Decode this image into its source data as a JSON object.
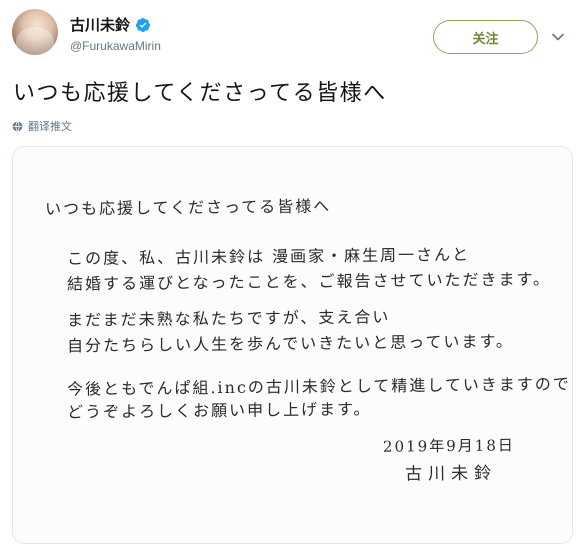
{
  "user": {
    "display_name": "古川未鈴",
    "handle": "@FurukawaMirin",
    "verified": true
  },
  "follow_button": {
    "label": "关注"
  },
  "tweet": {
    "text": "いつも応援してくださってる皆様へ",
    "translate_label": "翻译推文"
  },
  "letter": {
    "greeting": "いつも応援してくださってる皆様へ",
    "lines": [
      "この度、私、古川未鈴は 漫画家・麻生周一さんと",
      "結婚する運びとなったことを、ご報告させていただきます。",
      "まだまだ未熟な私たちですが、支え合い",
      "自分たちらしい人生を歩んでいきたいと思っています。",
      "今後ともでんぱ組.incの古川未鈴として精進していきますので",
      "どうぞよろしくお願い申し上げます。"
    ],
    "date": "2019年9月18日",
    "signature": "古川未鈴"
  },
  "colors": {
    "follow_border": "#8aa85c",
    "follow_text": "#6b8a3a",
    "verified_blue": "#1da1f2",
    "handle_gray": "#657786"
  },
  "icons": {
    "verified": "verified-badge-icon",
    "chevron": "chevron-down-icon",
    "globe": "globe-icon"
  }
}
